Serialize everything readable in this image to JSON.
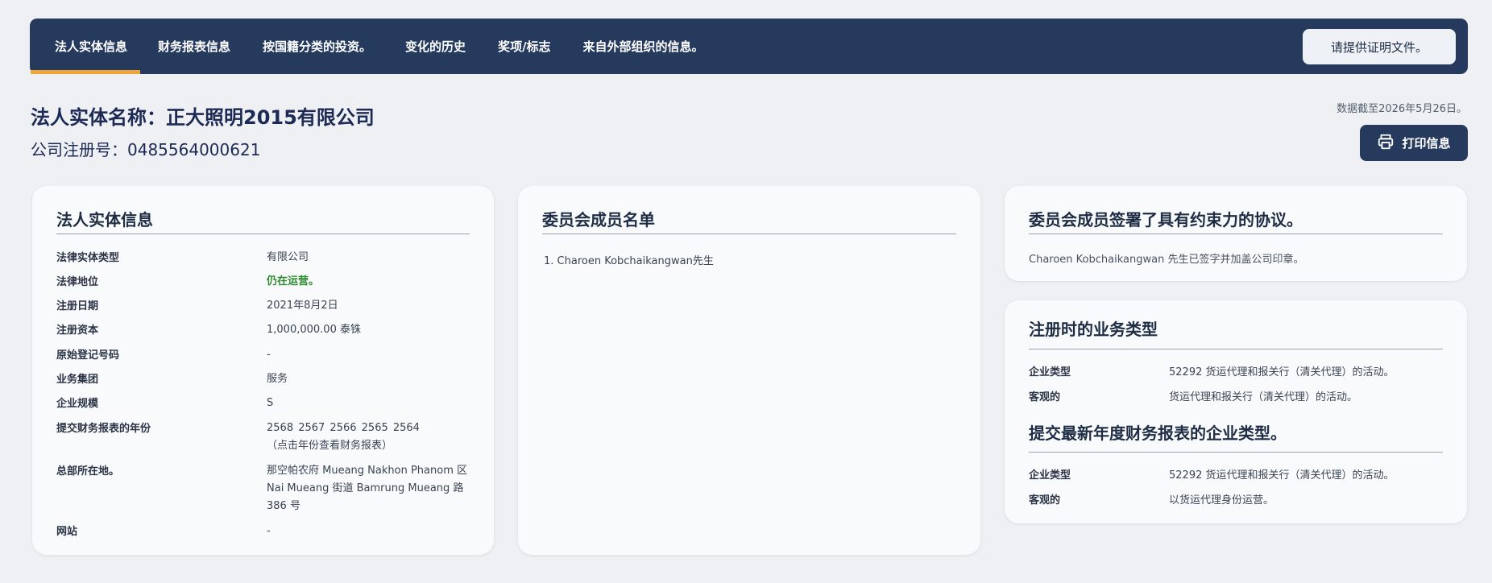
{
  "nav": {
    "tabs": [
      {
        "label": "法人实体信息",
        "active": true
      },
      {
        "label": "财务报表信息"
      },
      {
        "label": "按国籍分类的投资。"
      },
      {
        "label": "变化的历史"
      },
      {
        "label": "奖项/标志"
      },
      {
        "label": "来自外部组织的信息。"
      }
    ],
    "cert_button": "请提供证明文件。"
  },
  "header": {
    "entity_name": "法人实体名称：正大照明2015有限公司",
    "reg_number": "公司注册号：0485564000621",
    "as_of": "数据截至2026年5月26日。",
    "print_button": "打印信息",
    "print_icon": "printer-icon"
  },
  "entity_info": {
    "title": "法人实体信息",
    "fields": [
      {
        "label": "法律实体类型",
        "value": "有限公司"
      },
      {
        "label": "法律地位",
        "value": "仍在运营。",
        "status_color": "#2e8b2e"
      },
      {
        "label": "注册日期",
        "value": "2021年8月2日"
      },
      {
        "label": "注册资本",
        "value": "1,000,000.00 泰铢"
      },
      {
        "label": "原始登记号码",
        "value": "-"
      },
      {
        "label": "业务集团",
        "value": "服务"
      },
      {
        "label": "企业规模",
        "value": "S"
      },
      {
        "label": "提交财务报表的年份",
        "value": "2568  2567  2566  2565  2564",
        "note": "（点击年份查看财务报表）"
      },
      {
        "label": "总部所在地。",
        "value": "那空帕农府 Mueang Nakhon Phanom 区 Nai Mueang 街道 Bamrung Mueang 路 386 号"
      },
      {
        "label": "网站",
        "value": "-"
      }
    ]
  },
  "board": {
    "title": "委员会成员名单",
    "members": [
      "1. Charoen Kobchaikangwan先生"
    ]
  },
  "signing": {
    "title": "委员会成员签署了具有约束力的协议。",
    "text": "Charoen Kobchaikangwan 先生已签字并加盖公司印章。"
  },
  "business": {
    "registration_title": "注册时的业务类型",
    "registration": [
      {
        "label": "企业类型",
        "value": "52292 货运代理和报关行（清关代理）的活动。"
      },
      {
        "label": "客观的",
        "value": "货运代理和报关行（清关代理）的活动。"
      }
    ],
    "latest_title": "提交最新年度财务报表的企业类型。",
    "latest": [
      {
        "label": "企业类型",
        "value": "52292 货运代理和报关行（清关代理）的活动。"
      },
      {
        "label": "客观的",
        "value": "以货运代理身份运营。"
      }
    ]
  },
  "colors": {
    "nav_bg": "#263a5e",
    "active_tab_underline": "#f0a53a",
    "page_bg": "#eef0f3",
    "card_bg": "#f9fafc",
    "status_green": "#2e8b2e"
  }
}
